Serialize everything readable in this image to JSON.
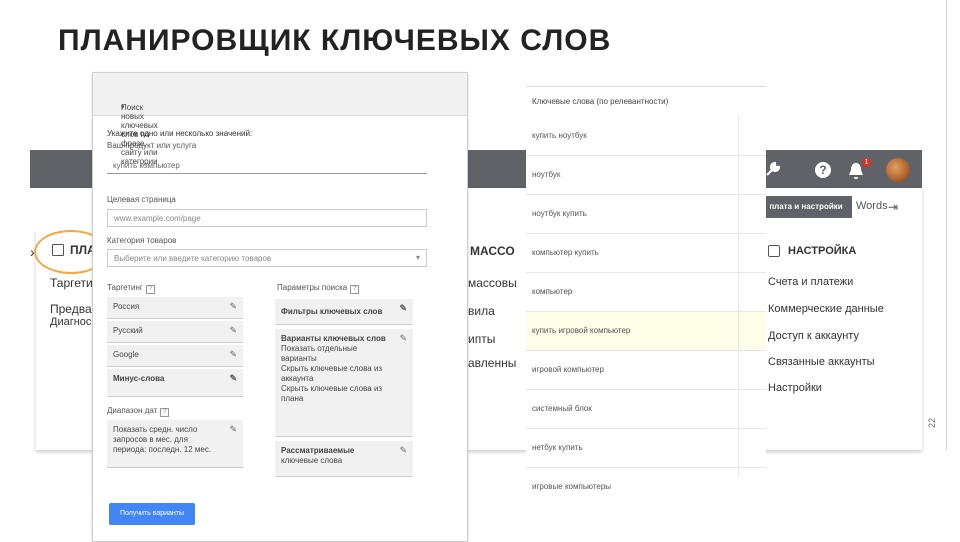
{
  "slide": {
    "title": "ПЛАНИРОВЩИК КЛЮЧЕВЫХ СЛОВ",
    "number": "22"
  },
  "background": {
    "frag_left_1": "ПЛА",
    "frag_left_2": "Таргети",
    "frag_left_3": "Предва",
    "frag_left_4": "Диагнос",
    "frag_mid_1": "МАССО",
    "frag_mid_2": "массовы",
    "frag_mid_3": "вила",
    "frag_mid_4": "ипты",
    "frag_mid_5": "авленны",
    "ads_frag": "Words",
    "tools_button": "плата и настройки"
  },
  "form": {
    "section_header": "Поиск новых ключевых слов по фразе, сайту или категории",
    "prompt_label": "Укажите одно или несколько значений:",
    "product_label": "Ваш продукт или услуга",
    "product_value": "купить компьютер",
    "landing_label": "Целевая страница",
    "landing_placeholder": "www.example.com/page",
    "category_label": "Категория товаров",
    "category_placeholder": "Выберите или введите категорию товаров",
    "targeting_label": "Таргетинг",
    "targeting_items": [
      "Россия",
      "Русский",
      "Google",
      "Минус-слова"
    ],
    "search_params_label": "Параметры поиска",
    "filter_chip": "Фильтры ключевых слов",
    "variants_title": "Варианты ключевых слов",
    "variants_lines": [
      "Показать отдельные",
      "варианты",
      "Скрыть ключевые слова из",
      "аккаунта",
      "Скрыть ключевые слова из",
      "плана"
    ],
    "considered_title": "Рассматриваемые",
    "considered_sub": "ключевые слова",
    "date_range_label": "Диапазон дат",
    "date_range_lines": [
      "Показать средн. число",
      "запросов в мес. для",
      "периода: последн. 12 мес."
    ],
    "submit_button": "Получить варианты"
  },
  "keywords": {
    "header": "Ключевые слова (по релевантности)",
    "rows": [
      "купить ноутбук",
      "ноутбук",
      "ноутбук купить",
      "компьютер купить",
      "компьютер",
      "купить игровой компьютер",
      "игровой компьютер",
      "системный блок",
      "нетбук купить",
      "игровые компьютеры"
    ],
    "highlighted_index": 5
  },
  "settings_menu": {
    "title": "НАСТРОЙКА",
    "items": [
      "Счета и платежи",
      "Коммерческие данные",
      "Доступ к аккаунту",
      "Связанные аккаунты",
      "Настройки"
    ]
  },
  "top_bar": {
    "notification_badge": "1",
    "icons": [
      "wrench-icon",
      "help-icon",
      "bell-icon",
      "avatar"
    ]
  },
  "colors": {
    "accent_blue": "#4285f4",
    "bar_gray": "#5f6368",
    "highlight_ring": "#f4a742",
    "badge_red": "#d93025"
  }
}
